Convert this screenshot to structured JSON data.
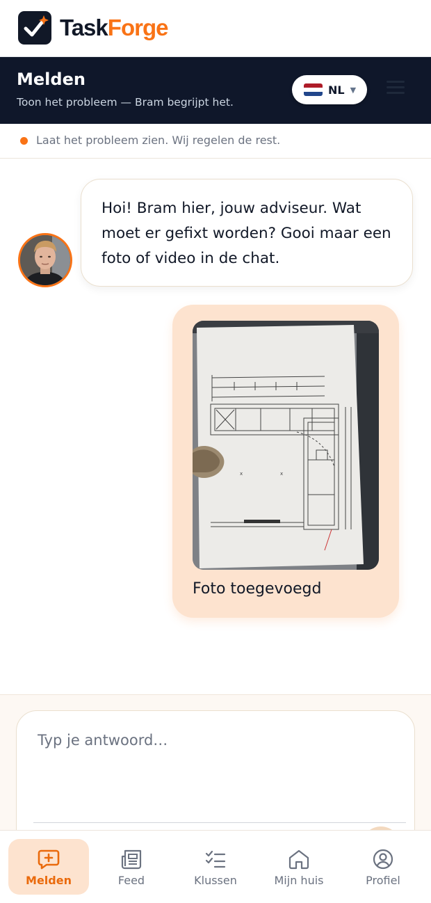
{
  "app": {
    "brand_part1": "Task",
    "brand_part2": "Forge",
    "accent_color": "#f97316"
  },
  "header": {
    "title": "Melden",
    "subtitle": "Toon het probleem — Bram begrijpt het.",
    "language": {
      "code": "NL",
      "flag_icon": "netherlands-flag-icon"
    },
    "menu_icon": "hamburger-menu-icon"
  },
  "status": {
    "text": "Laat het probleem zien. Wij regelen de rest."
  },
  "chat": {
    "messages": [
      {
        "sender": "advisor",
        "text": "Hoi! Bram hier, jouw adviseur. Wat moet er gefixt worden? Gooi maar een foto of video in de chat."
      },
      {
        "sender": "user",
        "attachment": "photo",
        "caption": "Foto toegevoegd"
      }
    ]
  },
  "composer": {
    "placeholder": "Typ je antwoord…",
    "value": ""
  },
  "nav": {
    "items": [
      {
        "label": "Melden",
        "icon": "chat-plus-icon",
        "active": true
      },
      {
        "label": "Feed",
        "icon": "newspaper-icon",
        "active": false
      },
      {
        "label": "Klussen",
        "icon": "checklist-icon",
        "active": false
      },
      {
        "label": "Mijn huis",
        "icon": "home-icon",
        "active": false
      },
      {
        "label": "Profiel",
        "icon": "user-circle-icon",
        "active": false
      }
    ]
  }
}
